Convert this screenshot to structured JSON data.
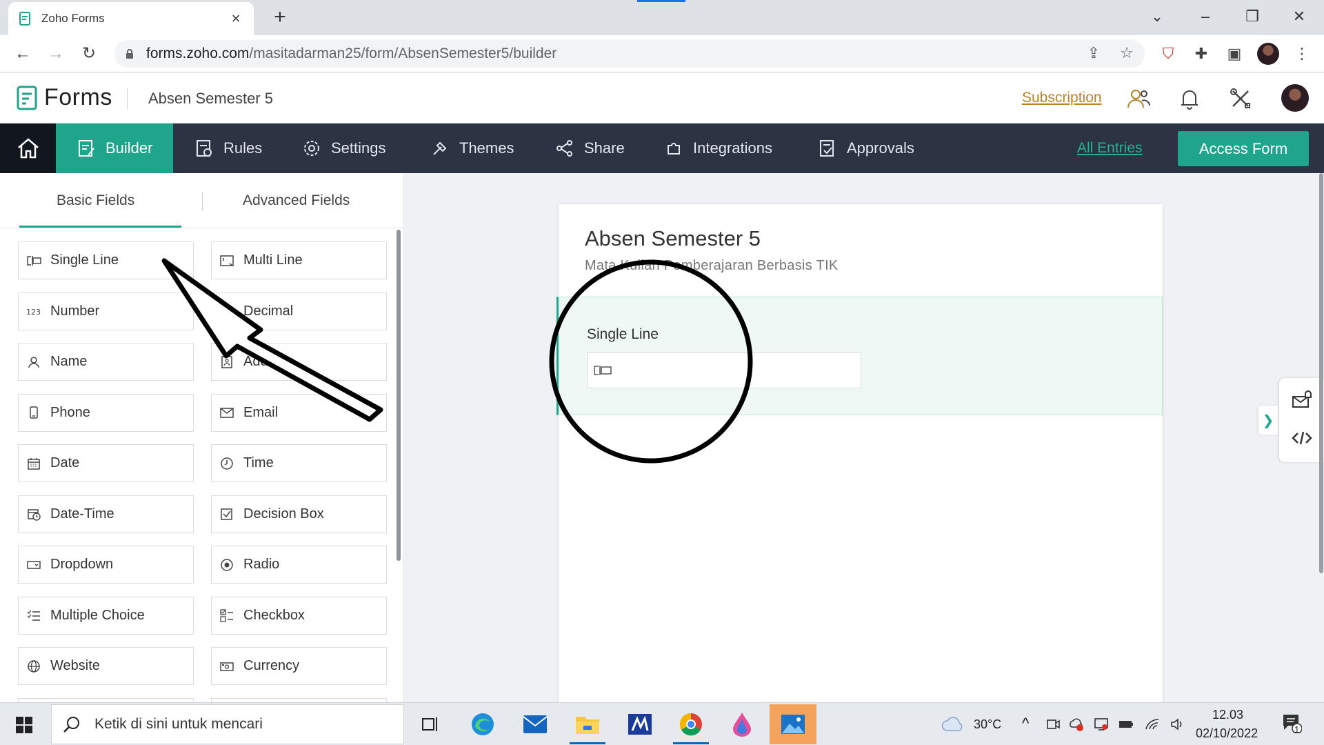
{
  "browser": {
    "tab_title": "Zoho Forms",
    "tab_close": "×",
    "new_tab": "+",
    "url_host": "forms.zoho.com",
    "url_path": "/masitadarman25/form/AbsenSemester5/builder"
  },
  "header": {
    "brand": "Forms",
    "form_name": "Absen Semester 5",
    "subscription": "Subscription"
  },
  "nav": {
    "items": [
      "Builder",
      "Rules",
      "Settings",
      "Themes",
      "Share",
      "Integrations",
      "Approvals"
    ],
    "all_entries": "All Entries",
    "access_form": "Access Form"
  },
  "sidebar": {
    "tabs": [
      "Basic Fields",
      "Advanced Fields"
    ],
    "fields": [
      {
        "label": "Single Line",
        "icon": "single-line-icon"
      },
      {
        "label": "Multi Line",
        "icon": "multi-line-icon"
      },
      {
        "label": "Number",
        "icon": "number-icon"
      },
      {
        "label": "Decimal",
        "icon": "decimal-icon"
      },
      {
        "label": "Name",
        "icon": "person-icon"
      },
      {
        "label": "Address",
        "icon": "address-icon"
      },
      {
        "label": "Phone",
        "icon": "phone-icon"
      },
      {
        "label": "Email",
        "icon": "envelope-icon"
      },
      {
        "label": "Date",
        "icon": "calendar-icon"
      },
      {
        "label": "Time",
        "icon": "clock-icon"
      },
      {
        "label": "Date-Time",
        "icon": "calendar-clock-icon"
      },
      {
        "label": "Decision Box",
        "icon": "checkbox-checked-icon"
      },
      {
        "label": "Dropdown",
        "icon": "dropdown-icon"
      },
      {
        "label": "Radio",
        "icon": "radio-icon"
      },
      {
        "label": "Multiple Choice",
        "icon": "list-check-icon"
      },
      {
        "label": "Checkbox",
        "icon": "checklist-icon"
      },
      {
        "label": "Website",
        "icon": "globe-icon"
      },
      {
        "label": "Currency",
        "icon": "money-icon"
      }
    ]
  },
  "form": {
    "title": "Absen Semester 5",
    "description": "Mata Kuliah Pemberajaran Berbasis TIK",
    "field_label": "Single Line"
  },
  "taskbar": {
    "search_placeholder": "Ketik di sini untuk mencari",
    "temperature": "30°C",
    "time": "12.03",
    "date": "02/10/2022",
    "notification_count": "1"
  },
  "colors": {
    "accent": "#1ea58b",
    "nav_bg": "#2c3444",
    "subscription": "#b8842a"
  }
}
